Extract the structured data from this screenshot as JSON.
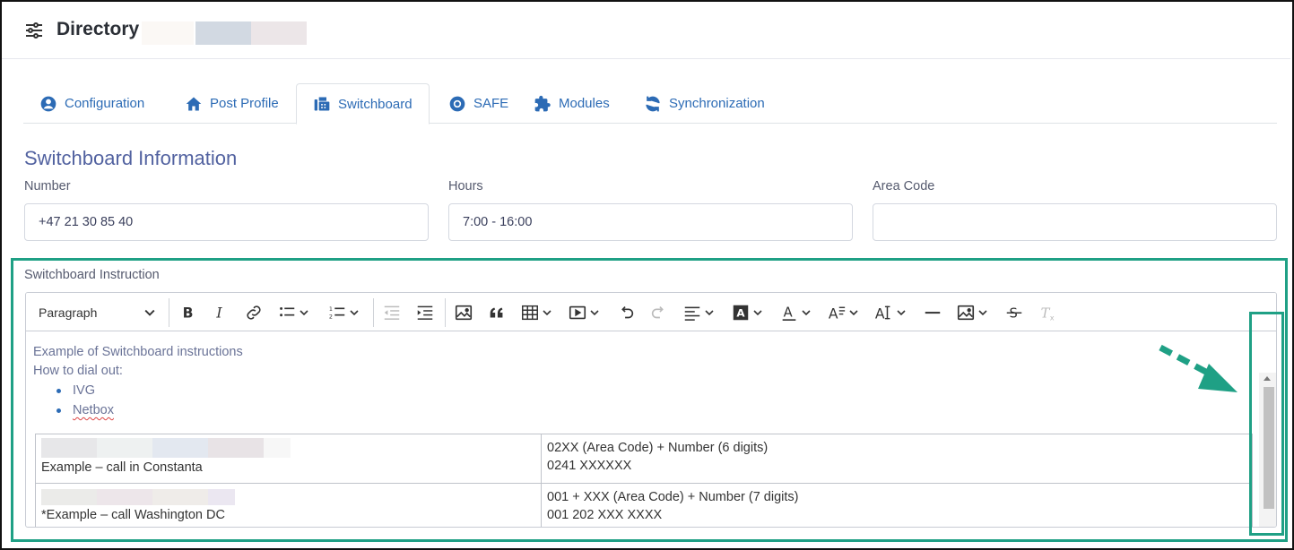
{
  "header": {
    "title": "Directory",
    "icon": "sliders-icon"
  },
  "tabs": [
    {
      "label": "Configuration",
      "icon": "user-circle-icon"
    },
    {
      "label": "Post Profile",
      "icon": "home-icon"
    },
    {
      "label": "Switchboard",
      "icon": "fax-icon",
      "active": true
    },
    {
      "label": "SAFE",
      "icon": "lifebuoy-icon"
    },
    {
      "label": "Modules",
      "icon": "puzzle-icon"
    },
    {
      "label": "Synchronization",
      "icon": "sync-icon"
    }
  ],
  "section": {
    "title": "Switchboard Information"
  },
  "fields": {
    "number": {
      "label": "Number",
      "value": "+47 21 30 85 40"
    },
    "hours": {
      "label": "Hours",
      "value": "7:00 - 16:00"
    },
    "area_code": {
      "label": "Area Code",
      "value": ""
    }
  },
  "instruction": {
    "label": "Switchboard Instruction",
    "toolbar": {
      "block_format": "Paragraph"
    },
    "content": {
      "line1": "Example of Switchboard instructions",
      "line2": "How to dial out:",
      "bullets": [
        "IVG",
        "Netbox"
      ],
      "table": [
        {
          "left": "Example – call in Constanta",
          "right1": "02XX (Area Code) + Number (6 digits)",
          "right2": "0241 XXXXXX"
        },
        {
          "left": "*Example – call Washington DC",
          "right1": "001 + XXX (Area Code) + Number (7 digits)",
          "right2": "001 202 XXX XXXX"
        }
      ]
    }
  },
  "colors": {
    "accent": "#2c6bb5",
    "highlight": "#1fa085",
    "heading": "#5262a0"
  }
}
